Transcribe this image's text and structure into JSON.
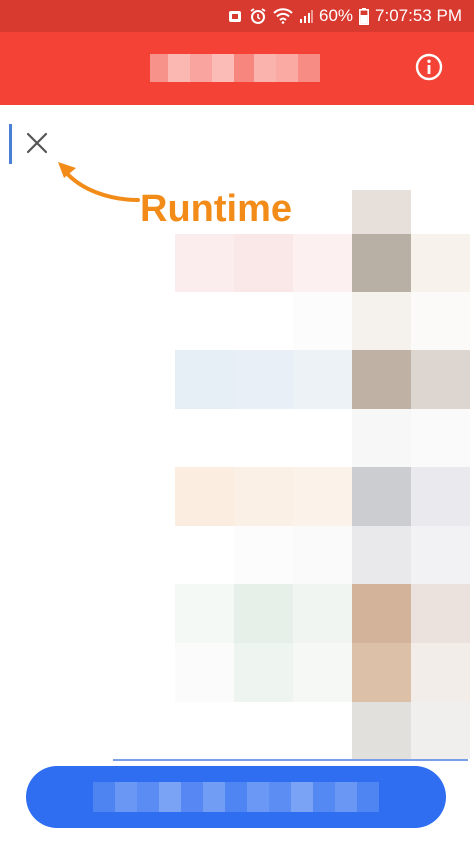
{
  "status_bar": {
    "battery_percent": "60%",
    "time": "7:07:53 PM"
  },
  "app_bar": {
    "title_obscured": true,
    "info_icon": "info-circle-icon"
  },
  "editor": {
    "close_icon": "close-icon",
    "annotation": "Runtime"
  },
  "bottom_button": {
    "label_obscured": true
  },
  "colors": {
    "status_bar": "#d83a30",
    "app_bar": "#f44336",
    "annotation": "#f28b18",
    "button": "#2f6ef0"
  }
}
